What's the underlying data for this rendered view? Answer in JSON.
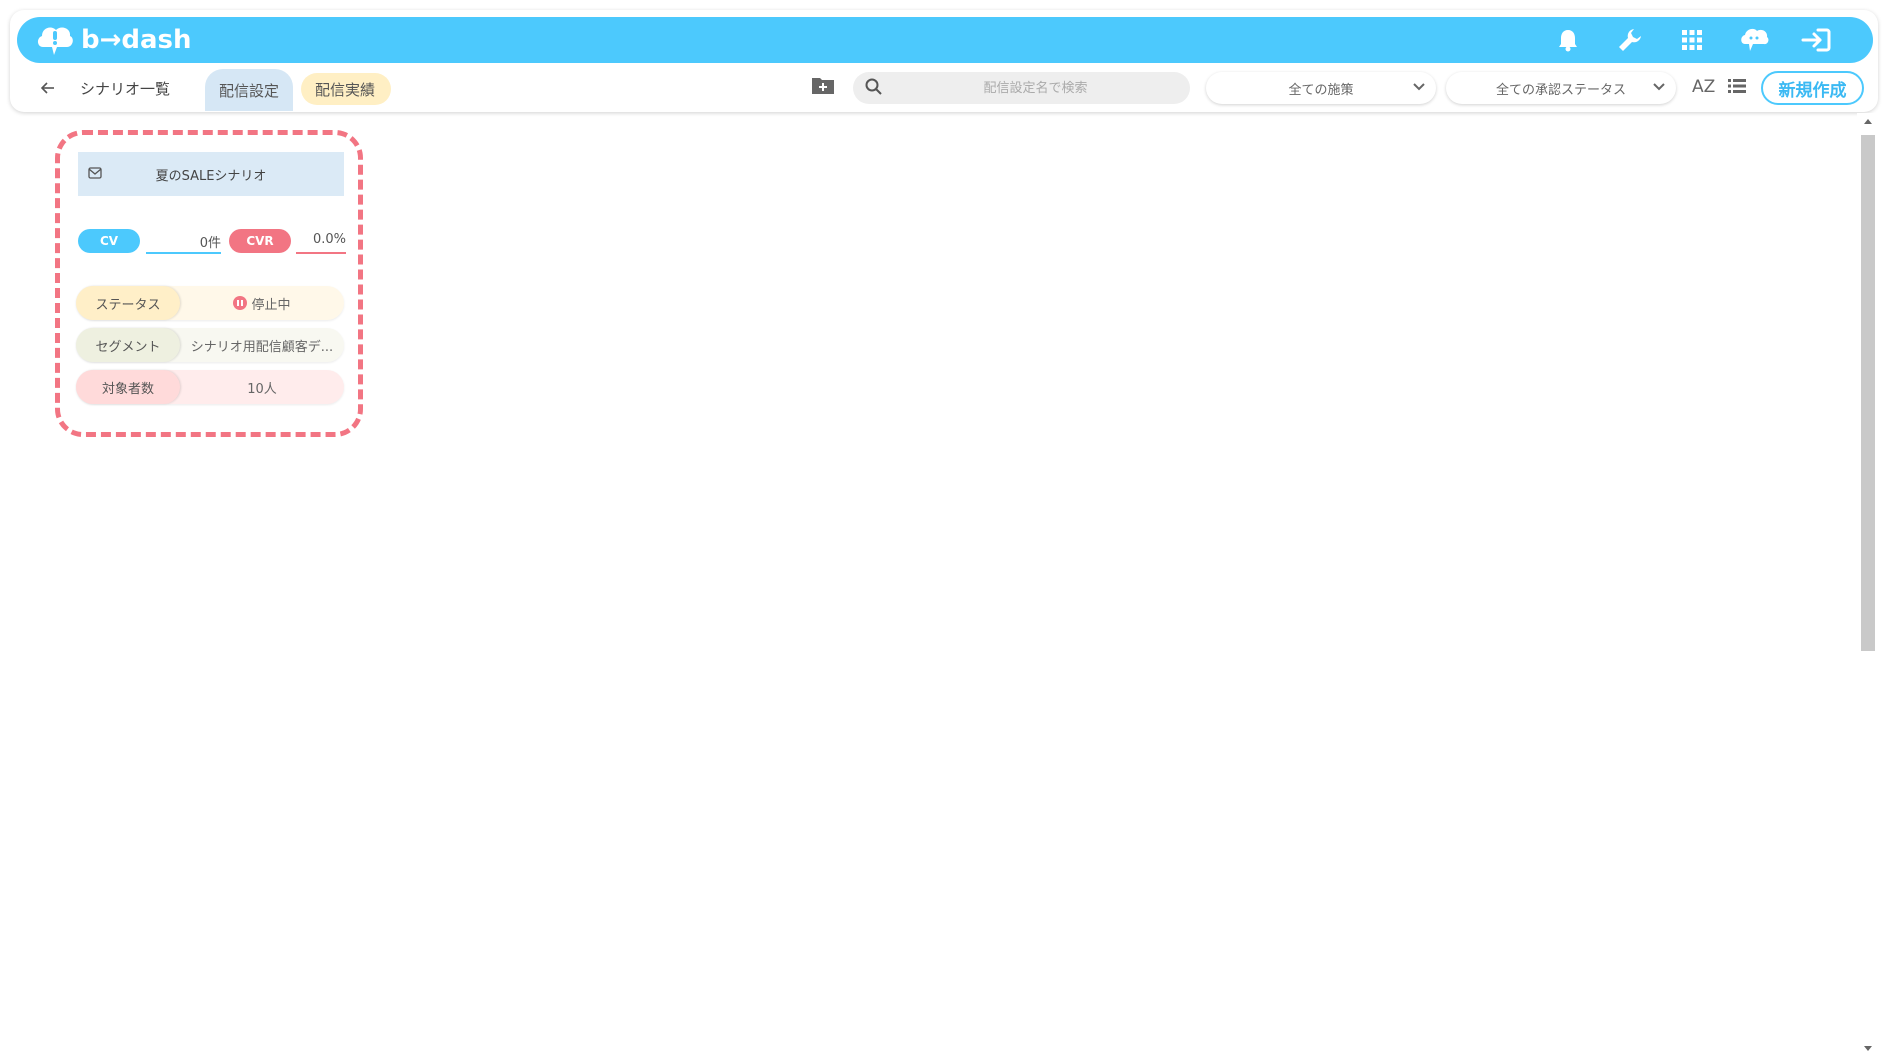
{
  "app": {
    "logo_text": "b→dash"
  },
  "topbar": {
    "icons": [
      "bell-icon",
      "wrench-icon",
      "apps-grid-icon",
      "chat-bot-icon",
      "logout-icon"
    ]
  },
  "subbar": {
    "breadcrumb": "シナリオ一覧",
    "tabs": [
      {
        "label": "配信設定",
        "active": true
      },
      {
        "label": "配信実績",
        "active": false
      }
    ],
    "search": {
      "placeholder": "配信設定名で検索",
      "value": ""
    },
    "filter_measures": "全ての施策",
    "filter_approval": "全ての承認ステータス",
    "sort_label": "AZ",
    "new_button": "新規作成"
  },
  "card": {
    "title": "夏のSALEシナリオ",
    "cv_label": "CV",
    "cv_value": "0件",
    "cvr_label": "CVR",
    "cvr_value": "0.0%",
    "rows": [
      {
        "label": "ステータス",
        "value": "停止中"
      },
      {
        "label": "セグメント",
        "value": "シナリオ用配信顧客デ..."
      },
      {
        "label": "対象者数",
        "value": "10人"
      }
    ]
  },
  "colors": {
    "brand": "#4cc9fd",
    "cvr": "#f27583",
    "highlight_outline": "#f27583"
  }
}
